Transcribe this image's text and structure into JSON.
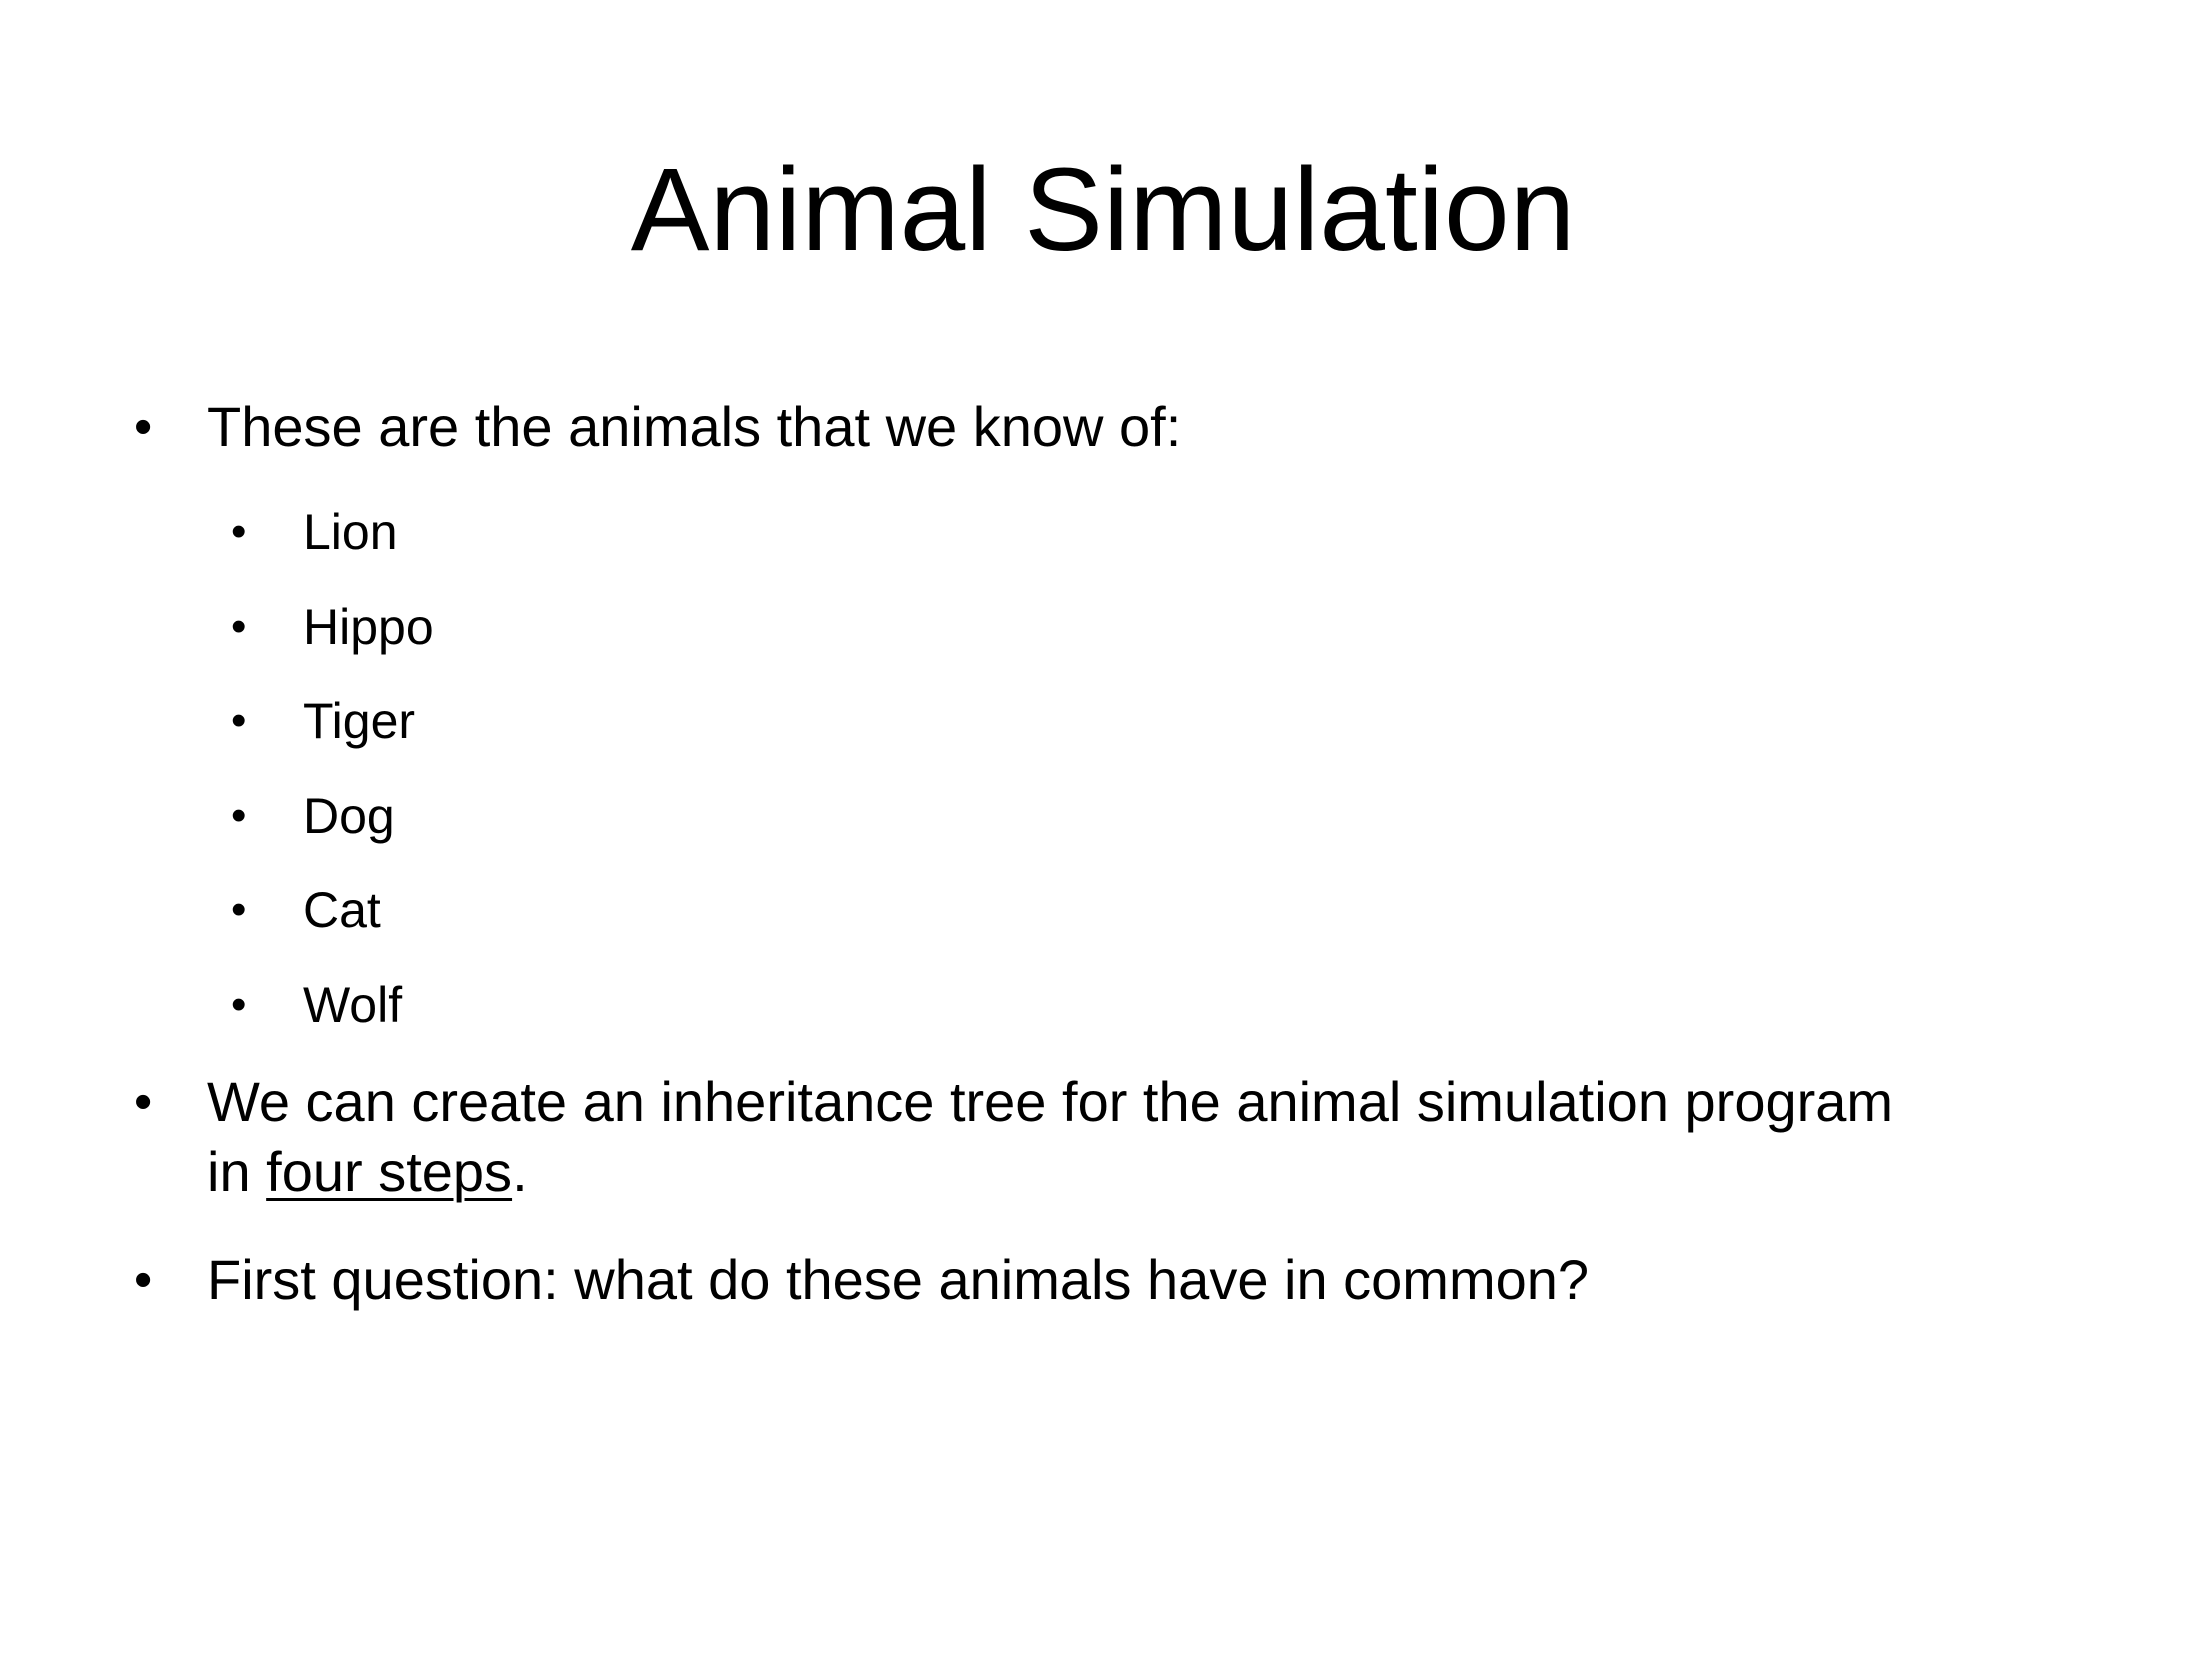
{
  "slide": {
    "title": "Animal Simulation",
    "bullets": [
      {
        "text": "These are the animals that we know of:"
      },
      {
        "line1": "We can create an inheritance tree for the animal simulation program",
        "line2_prefix": "in ",
        "line2_link": "four steps",
        "line2_suffix": "."
      },
      {
        "text": "First question: what do these animals have in common?"
      }
    ],
    "sub_bullets": [
      "Lion",
      "Hippo",
      "Tiger",
      "Dog",
      "Cat",
      "Wolf"
    ],
    "bullet_glyph": "•"
  }
}
